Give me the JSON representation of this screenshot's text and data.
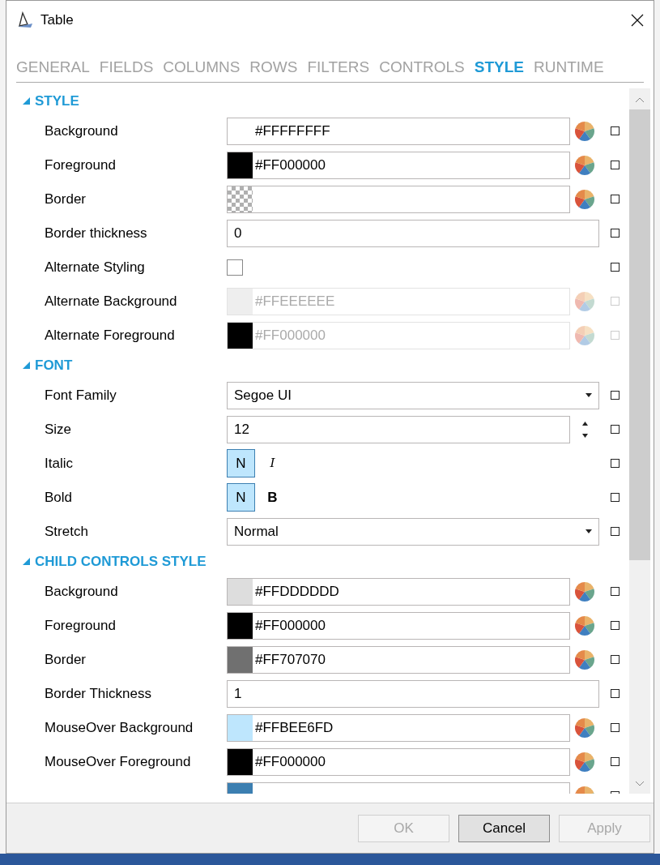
{
  "window": {
    "title": "Table"
  },
  "tabs": [
    {
      "label": "GENERAL",
      "selected": false
    },
    {
      "label": "FIELDS",
      "selected": false
    },
    {
      "label": "COLUMNS",
      "selected": false
    },
    {
      "label": "ROWS",
      "selected": false
    },
    {
      "label": "FILTERS",
      "selected": false
    },
    {
      "label": "CONTROLS",
      "selected": false
    },
    {
      "label": "STYLE",
      "selected": true
    },
    {
      "label": "RUNTIME",
      "selected": false
    }
  ],
  "sections": [
    {
      "title": "STYLE",
      "expanded": true,
      "rows": [
        {
          "kind": "color",
          "label": "Background",
          "value": "#FFFFFFFF",
          "color": "#ffffff",
          "disabled": false
        },
        {
          "kind": "color",
          "label": "Foreground",
          "value": "#FF000000",
          "color": "#000000",
          "disabled": false
        },
        {
          "kind": "transparent",
          "label": "Border",
          "disabled": false
        },
        {
          "kind": "text",
          "label": "Border thickness",
          "value": "0",
          "disabled": false
        },
        {
          "kind": "checkbox",
          "label": "Alternate Styling",
          "checked": false,
          "disabled": false
        },
        {
          "kind": "color",
          "label": "Alternate Background",
          "value": "#FFEEEEEE",
          "color": "#eeeeee",
          "disabled": true
        },
        {
          "kind": "color",
          "label": "Alternate Foreground",
          "value": "#FF000000",
          "color": "#000000",
          "disabled": true
        }
      ]
    },
    {
      "title": "FONT",
      "expanded": true,
      "rows": [
        {
          "kind": "dropdown",
          "label": "Font Family",
          "value": "Segoe UI",
          "disabled": false
        },
        {
          "kind": "spinner",
          "label": "Size",
          "value": "12",
          "disabled": false
        },
        {
          "kind": "toggle",
          "label": "Italic",
          "disabled": false,
          "options": [
            {
              "label": "N",
              "selected": true,
              "kind": "normal"
            },
            {
              "label": "I",
              "selected": false,
              "kind": "italic"
            }
          ]
        },
        {
          "kind": "toggle",
          "label": "Bold",
          "disabled": false,
          "options": [
            {
              "label": "N",
              "selected": true,
              "kind": "normal"
            },
            {
              "label": "B",
              "selected": false,
              "kind": "bold"
            }
          ]
        },
        {
          "kind": "dropdown",
          "label": "Stretch",
          "value": "Normal",
          "disabled": false
        }
      ]
    },
    {
      "title": "CHILD CONTROLS STYLE",
      "expanded": true,
      "rows": [
        {
          "kind": "color",
          "label": "Background",
          "value": "#FFDDDDDD",
          "color": "#dddddd",
          "disabled": false
        },
        {
          "kind": "color",
          "label": "Foreground",
          "value": "#FF000000",
          "color": "#000000",
          "disabled": false
        },
        {
          "kind": "color",
          "label": "Border",
          "value": "#FF707070",
          "color": "#707070",
          "disabled": false
        },
        {
          "kind": "text",
          "label": "Border Thickness",
          "value": "1",
          "disabled": false
        },
        {
          "kind": "color",
          "label": "MouseOver Background",
          "value": "#FFBEE6FD",
          "color": "#bee6fd",
          "disabled": false
        },
        {
          "kind": "color",
          "label": "MouseOver Foreground",
          "value": "#FF000000",
          "color": "#000000",
          "disabled": false
        },
        {
          "kind": "color",
          "color": "#3c7fb1",
          "disabled": false
        }
      ]
    }
  ],
  "buttons": [
    {
      "label": "OK",
      "disabled": true
    },
    {
      "label": "Cancel",
      "disabled": false
    },
    {
      "label": "Apply",
      "disabled": true
    }
  ]
}
